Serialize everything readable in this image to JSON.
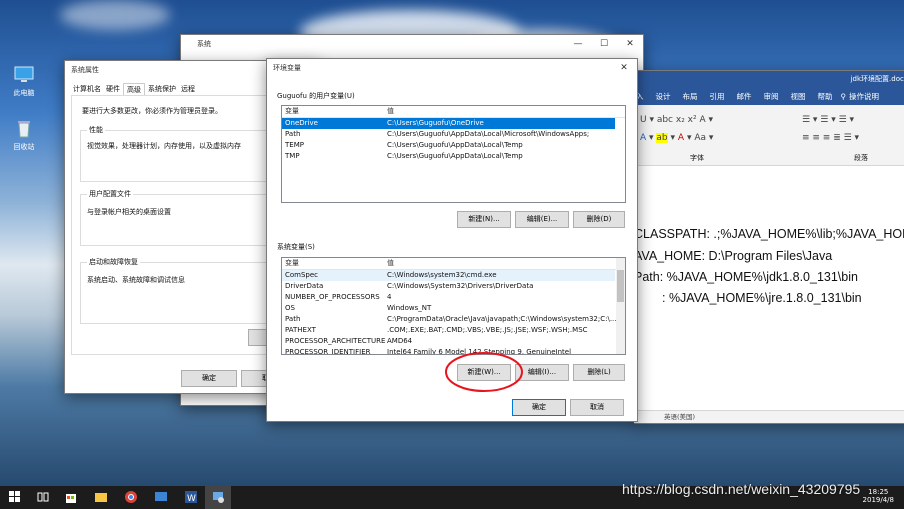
{
  "desktop": {
    "icons": [
      "此电脑",
      "回收站"
    ],
    "watermark": "https://blog.csdn.net/weixin_43209795"
  },
  "system_window": {
    "title": "系统"
  },
  "system_props": {
    "title": "系统属性",
    "tabs": [
      "计算机名",
      "硬件",
      "高级",
      "系统保护",
      "远程"
    ],
    "notice": "要进行大多数更改，你必须作为管理员登录。",
    "perf_title": "性能",
    "perf_desc": "视觉效果，处理器计划，内存使用，以及虚拟内存",
    "profile_title": "用户配置文件",
    "profile_desc": "与登录帐户相关的桌面设置",
    "startup_title": "启动和故障恢复",
    "startup_desc": "系统启动、系统故障和调试信息",
    "ok": "确定",
    "cancel": "取消"
  },
  "env_dialog": {
    "title": "环境变量",
    "user_section": "Guguofu 的用户变量(U)",
    "col_var": "变量",
    "col_val": "值",
    "user_vars": [
      {
        "name": "OneDrive",
        "value": "C:\\Users\\Guguofu\\OneDrive"
      },
      {
        "name": "Path",
        "value": "C:\\Users\\Guguofu\\AppData\\Local\\Microsoft\\WindowsApps;"
      },
      {
        "name": "TEMP",
        "value": "C:\\Users\\Guguofu\\AppData\\Local\\Temp"
      },
      {
        "name": "TMP",
        "value": "C:\\Users\\Guguofu\\AppData\\Local\\Temp"
      }
    ],
    "user_new": "新建(N)...",
    "user_edit": "编辑(E)...",
    "user_delete": "删除(D)",
    "sys_section": "系统变量(S)",
    "sys_vars": [
      {
        "name": "ComSpec",
        "value": "C:\\Windows\\system32\\cmd.exe"
      },
      {
        "name": "DriverData",
        "value": "C:\\Windows\\System32\\Drivers\\DriverData"
      },
      {
        "name": "NUMBER_OF_PROCESSORS",
        "value": "4"
      },
      {
        "name": "OS",
        "value": "Windows_NT"
      },
      {
        "name": "Path",
        "value": "C:\\ProgramData\\Oracle\\Java\\javapath;C:\\Windows\\system32;C:\\..."
      },
      {
        "name": "PATHEXT",
        "value": ".COM;.EXE;.BAT;.CMD;.VBS;.VBE;.JS;.JSE;.WSF;.WSH;.MSC"
      },
      {
        "name": "PROCESSOR_ARCHITECTURE",
        "value": "AMD64"
      },
      {
        "name": "PROCESSOR_IDENTIFIER",
        "value": "Intel64 Family 6 Model 142 Stepping 9, GenuineIntel"
      }
    ],
    "sys_new": "新建(W)...",
    "sys_edit": "编辑(I)...",
    "sys_delete": "删除(L)",
    "ok": "确定",
    "cancel": "取消"
  },
  "word": {
    "title": "jdk环境配置.docx",
    "ribbon_tabs": [
      "入",
      "设计",
      "布局",
      "引用",
      "邮件",
      "审阅",
      "视图",
      "帮助"
    ],
    "search_hint": "操作说明",
    "group_font": "字体",
    "group_para": "段落",
    "lines": [
      "CLASSPATH:  .;%JAVA_HOME%\\lib;%JAVA_HOM",
      "AVA_HOME: D:\\Program Files\\Java",
      "Path:   %JAVA_HOME%\\jdk1.8.0_131\\bin",
      ":   %JAVA_HOME%\\jre.1.8.0_131\\bin"
    ],
    "status": "英语(美国)"
  },
  "taskbar": {
    "time": "18:25",
    "date": "2019/4/8"
  },
  "colors": {
    "accent": "#0078d7",
    "annotation": "#e8141e",
    "taskbar": "#1c1c1c"
  }
}
